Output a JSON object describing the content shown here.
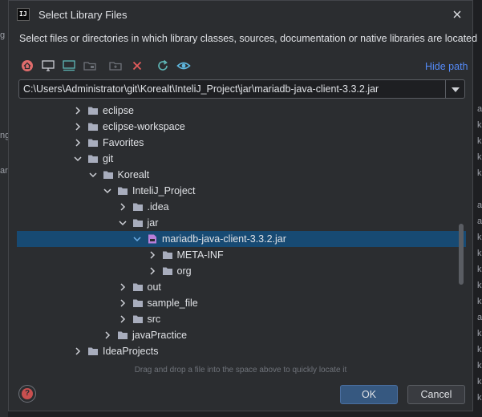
{
  "dialog": {
    "title": "Select Library Files",
    "app_logo_text": "IJ",
    "description": "Select files or directories in which library classes, sources, documentation or native libraries are located",
    "hide_path_label": "Hide path",
    "path_value": "C:\\Users\\Administrator\\git\\Korealt\\InteliJ_Project\\jar\\mariadb-java-client-3.3.2.jar",
    "hint": "Drag and drop a file into the space above to quickly locate it",
    "ok_label": "OK",
    "cancel_label": "Cancel"
  },
  "toolbar": {
    "icons": [
      "home-icon",
      "desktop-icon",
      "project-icon",
      "module-icon",
      "new-folder-icon",
      "delete-icon",
      "refresh-icon",
      "show-hidden-icon"
    ]
  },
  "tree": [
    {
      "label": "eclipse",
      "kind": "folder",
      "state": "collapsed"
    },
    {
      "label": "eclipse-workspace",
      "kind": "folder",
      "state": "collapsed"
    },
    {
      "label": "Favorites",
      "kind": "folder",
      "state": "collapsed"
    },
    {
      "label": "git",
      "kind": "folder",
      "state": "expanded"
    },
    {
      "label": "Korealt",
      "kind": "folder",
      "state": "expanded"
    },
    {
      "label": "InteliJ_Project",
      "kind": "folder",
      "state": "expanded"
    },
    {
      "label": ".idea",
      "kind": "folder",
      "state": "collapsed"
    },
    {
      "label": "jar",
      "kind": "folder",
      "state": "expanded"
    },
    {
      "label": "mariadb-java-client-3.3.2.jar",
      "kind": "jar",
      "state": "expanded",
      "selected": true
    },
    {
      "label": "META-INF",
      "kind": "folder",
      "state": "collapsed"
    },
    {
      "label": "org",
      "kind": "folder",
      "state": "collapsed"
    },
    {
      "label": "out",
      "kind": "folder",
      "state": "collapsed"
    },
    {
      "label": "sample_file",
      "kind": "folder",
      "state": "collapsed"
    },
    {
      "label": "src",
      "kind": "folder",
      "state": "collapsed"
    },
    {
      "label": "javaPractice",
      "kind": "folder",
      "state": "collapsed"
    },
    {
      "label": "IdeaProjects",
      "kind": "folder",
      "state": "collapsed"
    }
  ],
  "background": {
    "left_fragments": [
      "g",
      "ng",
      "ar"
    ],
    "right_fragments": [
      "ar",
      "k",
      "k",
      "k",
      "k",
      "ar",
      "ar",
      "k",
      "k",
      "k",
      "k",
      "k",
      "ar",
      "k",
      "k",
      "k",
      "k",
      "k"
    ]
  },
  "colors": {
    "dialog_bg": "#2b2d30",
    "selection": "#174a73",
    "accent_link": "#548af7",
    "ok_button": "#365880",
    "folder": "#a8adbd",
    "jar_icon": "#b87fd9"
  }
}
